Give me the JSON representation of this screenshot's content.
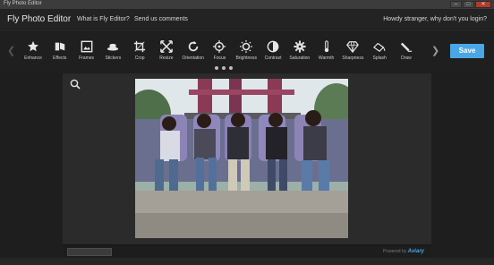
{
  "window": {
    "title": "Fly Photo Editor",
    "controls": [
      "–",
      "□",
      "✕"
    ]
  },
  "header": {
    "brand": "Fly Photo Editor",
    "links": [
      "What is Fly Editor?",
      "Send us comments"
    ],
    "login_text": "Howdy stranger, why don't you login?"
  },
  "toolbar": {
    "tools": [
      {
        "label": "Enhance",
        "icon": "star-icon"
      },
      {
        "label": "Effects",
        "icon": "effects-icon"
      },
      {
        "label": "Frames",
        "icon": "frame-icon"
      },
      {
        "label": "Stickers",
        "icon": "hat-icon"
      },
      {
        "label": "Crop",
        "icon": "crop-icon"
      },
      {
        "label": "Resize",
        "icon": "resize-icon"
      },
      {
        "label": "Orientation",
        "icon": "rotate-icon"
      },
      {
        "label": "Focus",
        "icon": "focus-icon"
      },
      {
        "label": "Brightness",
        "icon": "sun-icon"
      },
      {
        "label": "Contrast",
        "icon": "contrast-icon"
      },
      {
        "label": "Saturation",
        "icon": "gear-icon"
      },
      {
        "label": "Warmth",
        "icon": "thermometer-icon"
      },
      {
        "label": "Sharpness",
        "icon": "diamond-icon"
      },
      {
        "label": "Splash",
        "icon": "splash-icon"
      },
      {
        "label": "Draw",
        "icon": "pencil-icon"
      }
    ],
    "save_label": "Save",
    "page_dots": 3
  },
  "footer": {
    "powered_by_prefix": "Powered by",
    "powered_by_brand": "Aviary"
  },
  "colors": {
    "accent": "#4aa7e6",
    "background": "#2a2a2a",
    "toolbar": "#1f1f1f"
  }
}
